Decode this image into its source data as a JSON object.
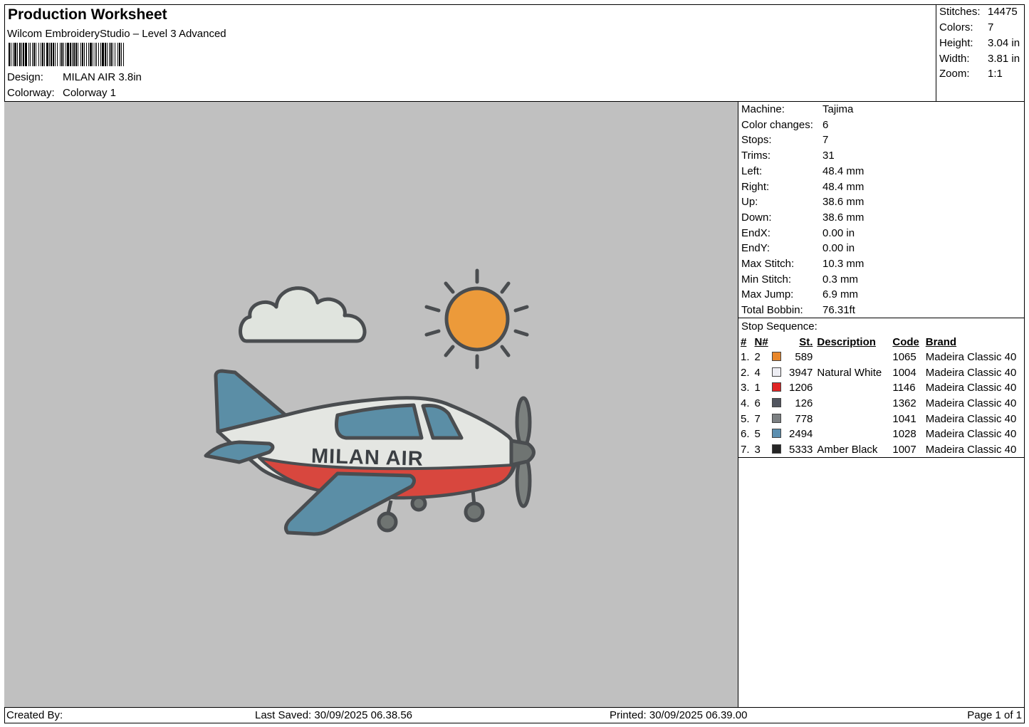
{
  "header": {
    "title": "Production Worksheet",
    "software": "Wilcom EmbroideryStudio – Level 3 Advanced",
    "design_label": "Design:",
    "design_value": "MILAN AIR 3.8in",
    "colorway_label": "Colorway:",
    "colorway_value": "Colorway 1"
  },
  "stats": {
    "stitches_label": "Stitches:",
    "stitches_value": "14475",
    "colors_label": "Colors:",
    "colors_value": "7",
    "height_label": "Height:",
    "height_value": "3.04 in",
    "width_label": "Width:",
    "width_value": "3.81 in",
    "zoom_label": "Zoom:",
    "zoom_value": "1:1"
  },
  "machine_info": [
    {
      "label": "Machine:",
      "value": "Tajima"
    },
    {
      "label": "Color changes:",
      "value": "6"
    },
    {
      "label": "Stops:",
      "value": "7"
    },
    {
      "label": "Trims:",
      "value": "31"
    },
    {
      "label": "Left:",
      "value": "48.4 mm"
    },
    {
      "label": "Right:",
      "value": "48.4 mm"
    },
    {
      "label": "Up:",
      "value": "38.6 mm"
    },
    {
      "label": "Down:",
      "value": "38.6 mm"
    },
    {
      "label": "EndX:",
      "value": "0.00 in"
    },
    {
      "label": "EndY:",
      "value": "0.00 in"
    },
    {
      "label": "Max Stitch:",
      "value": "10.3 mm"
    },
    {
      "label": "Min Stitch:",
      "value": "0.3 mm"
    },
    {
      "label": "Max Jump:",
      "value": "6.9 mm"
    },
    {
      "label": "Total Bobbin:",
      "value": "76.31ft"
    }
  ],
  "stop_sequence": {
    "caption": "Stop Sequence:",
    "headers": {
      "idx": "#",
      "n": "N#",
      "st": "St.",
      "desc": "Description",
      "code": "Code",
      "brand": "Brand"
    },
    "rows": [
      {
        "idx": "1.",
        "n": "2",
        "color": "#e8862a",
        "st": "589",
        "desc": "",
        "code": "1065",
        "brand": "Madeira Classic 40"
      },
      {
        "idx": "2.",
        "n": "4",
        "color": "#ededf3",
        "st": "3947",
        "desc": "Natural White",
        "code": "1004",
        "brand": "Madeira Classic 40"
      },
      {
        "idx": "3.",
        "n": "1",
        "color": "#e02424",
        "st": "1206",
        "desc": "",
        "code": "1146",
        "brand": "Madeira Classic 40"
      },
      {
        "idx": "4.",
        "n": "6",
        "color": "#51555f",
        "st": "126",
        "desc": "",
        "code": "1362",
        "brand": "Madeira Classic 40"
      },
      {
        "idx": "5.",
        "n": "7",
        "color": "#7c8082",
        "st": "778",
        "desc": "",
        "code": "1041",
        "brand": "Madeira Classic 40"
      },
      {
        "idx": "6.",
        "n": "5",
        "color": "#5c8fb0",
        "st": "2494",
        "desc": "",
        "code": "1028",
        "brand": "Madeira Classic 40"
      },
      {
        "idx": "7.",
        "n": "3",
        "color": "#262626",
        "st": "5333",
        "desc": "Amber Black",
        "code": "1007",
        "brand": "Madeira Classic 40"
      }
    ]
  },
  "design": {
    "airplane_text": "MILAN AIR",
    "colors": {
      "canvas": "#c0c0c0",
      "outline": "#4a4d50",
      "sun": "#ec9a3a",
      "cloud": "#e0e4de",
      "body": "#e4e6e2",
      "stripe": "#d8473e",
      "blue": "#5b8ea6",
      "gray": "#7b807e"
    }
  },
  "footer": {
    "created_by": "Created By:",
    "last_saved": "Last Saved: 30/09/2025 06.38.56",
    "printed": "Printed: 30/09/2025 06.39.00",
    "page": "Page 1 of 1"
  }
}
